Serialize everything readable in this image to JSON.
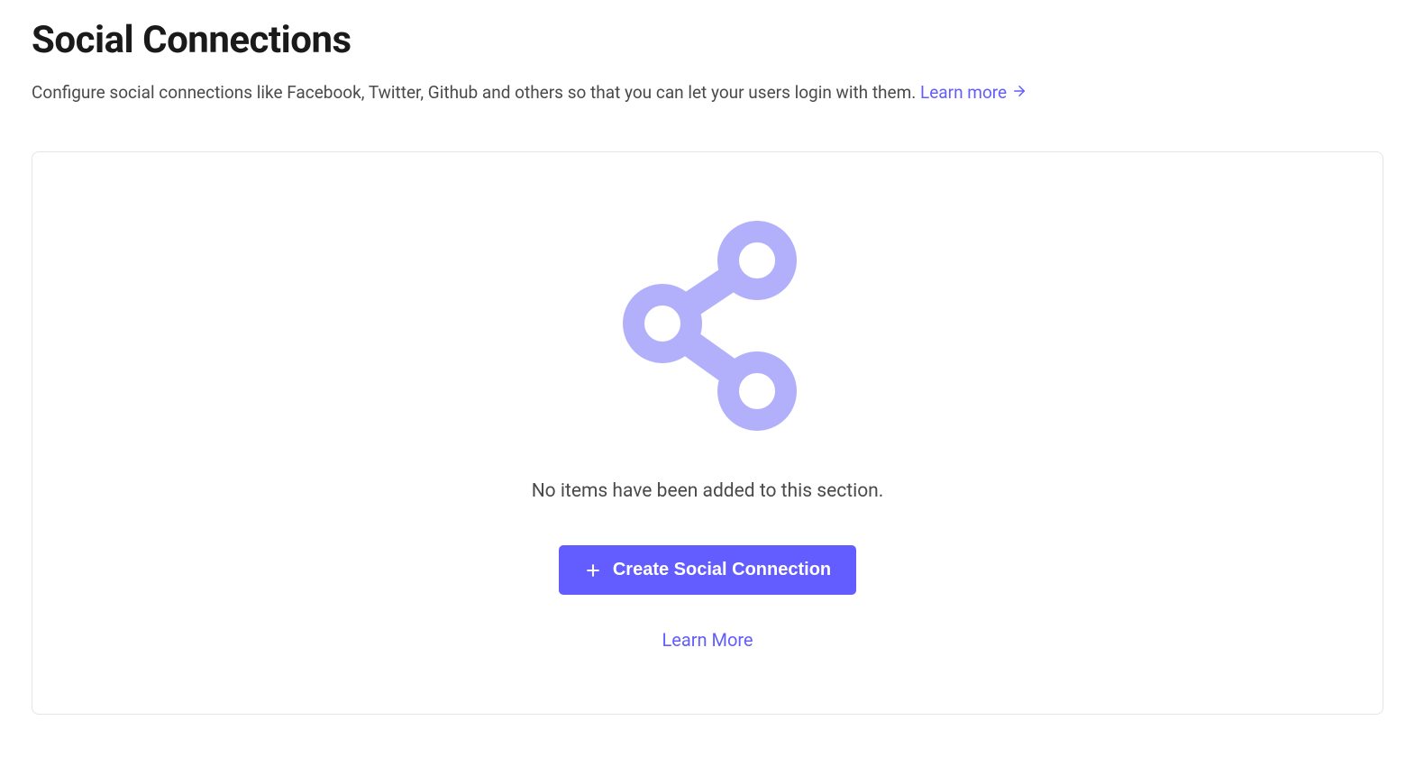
{
  "header": {
    "title": "Social Connections",
    "description": "Configure social connections like Facebook, Twitter, Github and others so that you can let your users login with them. ",
    "learn_more_label": "Learn more"
  },
  "empty_state": {
    "message": "No items have been added to this section.",
    "create_button_label": "Create Social Connection",
    "learn_more_label": "Learn More"
  },
  "colors": {
    "accent": "#635dff",
    "icon_light": "#B3B0FB"
  }
}
